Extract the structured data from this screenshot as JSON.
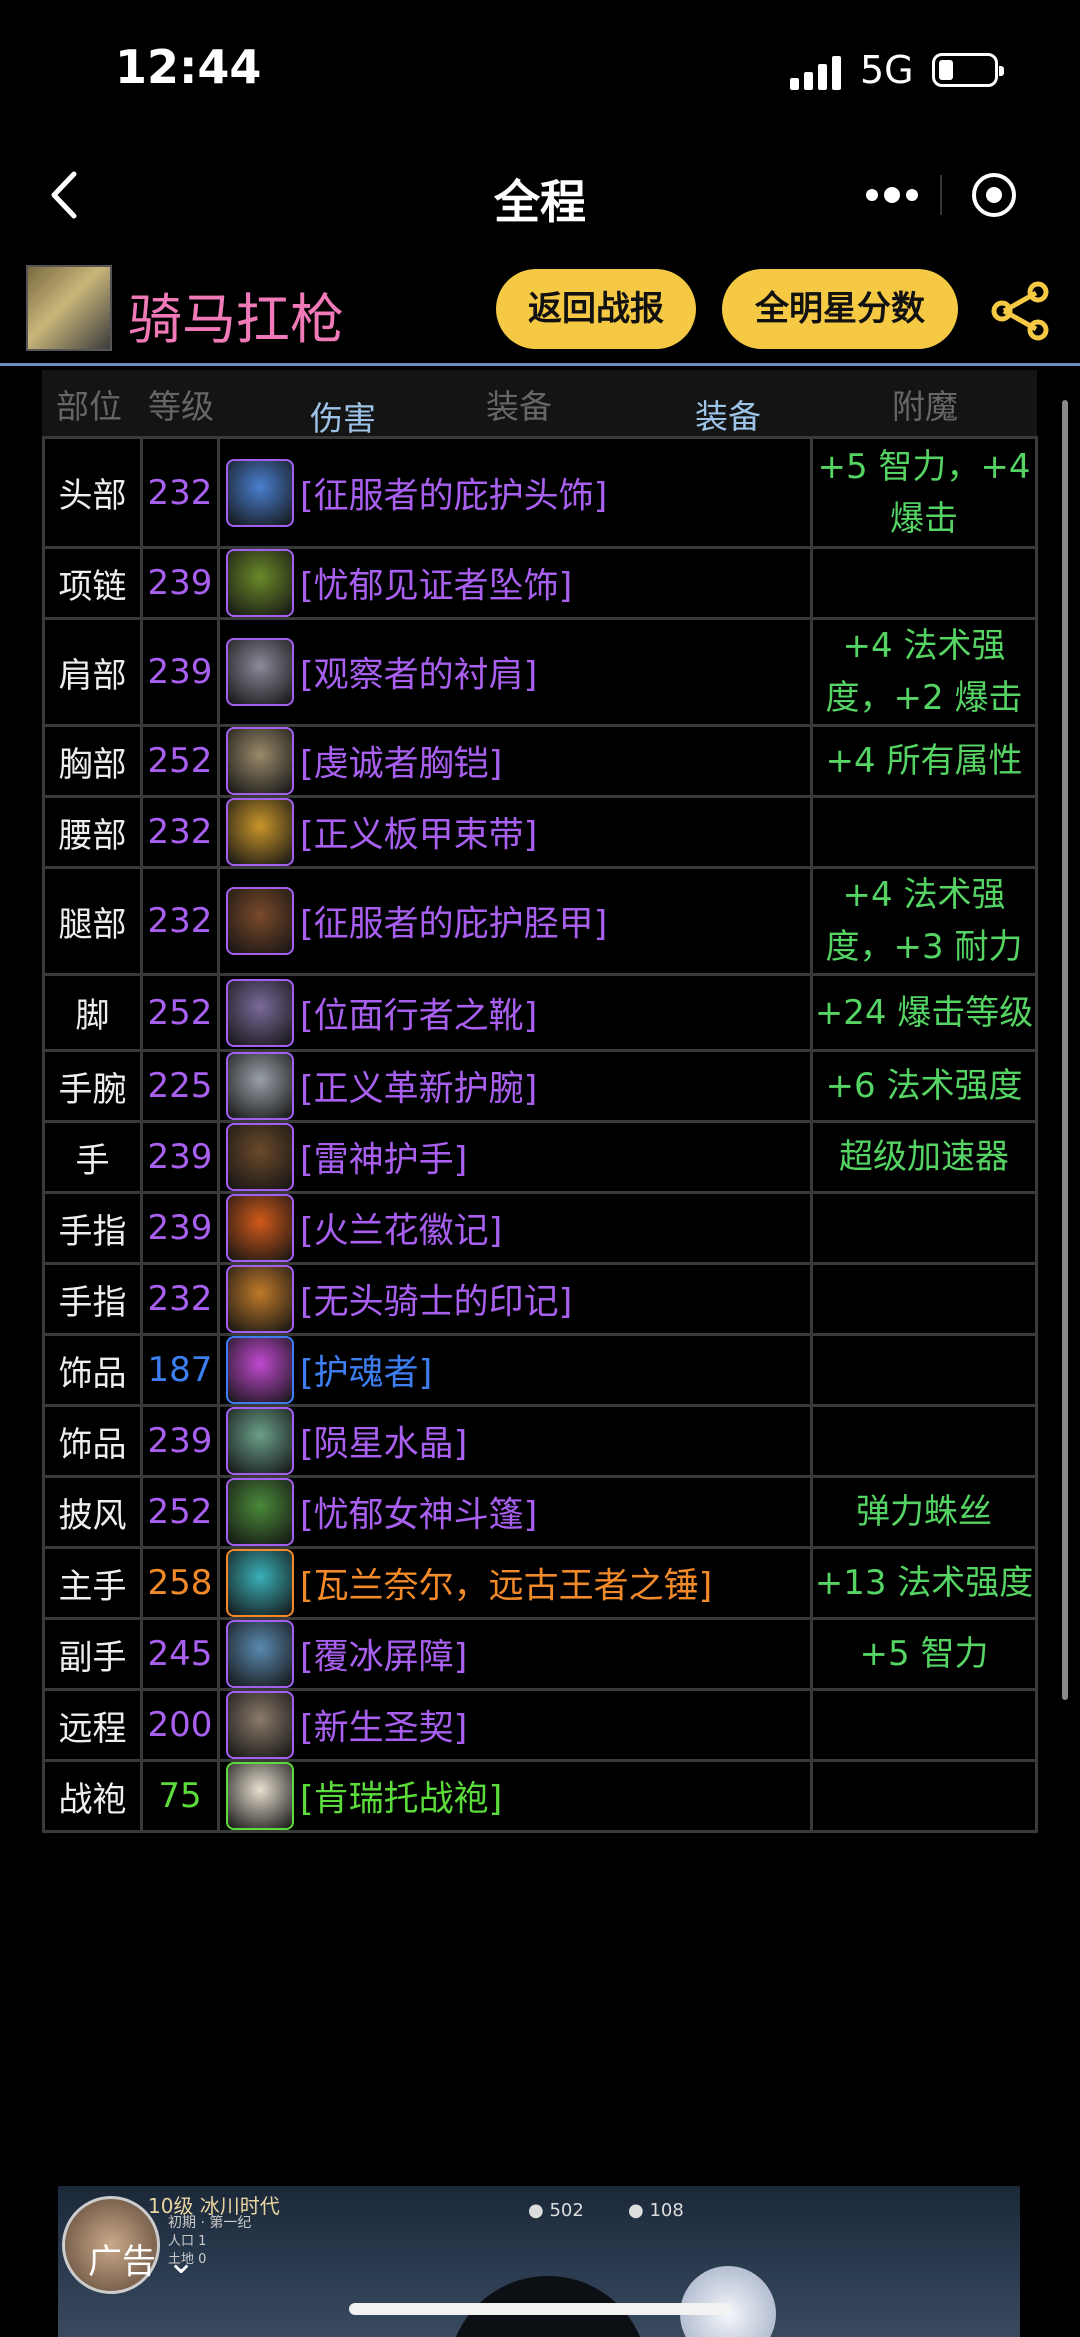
{
  "status": {
    "time": "12:44",
    "network": "5G"
  },
  "nav": {
    "title": "全程"
  },
  "header": {
    "player_name": "骑马扛枪",
    "return_button": "返回战报",
    "allstar_button": "全明星分数"
  },
  "columns": {
    "slot": "部位",
    "level": "等级",
    "damage": "伤害",
    "gear_inactive": "装备",
    "gear_active": "装备",
    "enchant": "附魔"
  },
  "gear": [
    {
      "slot": "头部",
      "level": "232",
      "item": "[征服者的庇护头饰]",
      "enchant": "+5 智力，+4 爆击",
      "quality": "epic",
      "icon": "helm-icon",
      "icon_color": "#4a7fd0"
    },
    {
      "slot": "项链",
      "level": "239",
      "item": "[忧郁见证者坠饰]",
      "enchant": "",
      "quality": "epic",
      "icon": "amulet-icon",
      "icon_color": "#6b8a2a"
    },
    {
      "slot": "肩部",
      "level": "239",
      "item": "[观察者的衬肩]",
      "enchant": "+4 法术强度，+2 爆击",
      "quality": "epic",
      "icon": "shoulder-icon",
      "icon_color": "#8a8a9a"
    },
    {
      "slot": "胸部",
      "level": "252",
      "item": "[虔诚者胸铠]",
      "enchant": "+4 所有属性",
      "quality": "epic",
      "icon": "chest-icon",
      "icon_color": "#9a8a6a"
    },
    {
      "slot": "腰部",
      "level": "232",
      "item": "[正义板甲束带]",
      "enchant": "",
      "quality": "epic",
      "icon": "belt-icon",
      "icon_color": "#c9962a"
    },
    {
      "slot": "腿部",
      "level": "232",
      "item": "[征服者的庇护胫甲]",
      "enchant": "+4 法术强度，+3 耐力",
      "quality": "epic",
      "icon": "legs-icon",
      "icon_color": "#7a4a2a"
    },
    {
      "slot": "脚",
      "level": "252",
      "item": "[位面行者之靴]",
      "enchant": "+24 爆击等级",
      "quality": "epic",
      "icon": "boots-icon",
      "icon_color": "#7a6a9a"
    },
    {
      "slot": "手腕",
      "level": "225",
      "item": "[正义革新护腕]",
      "enchant": "+6 法术强度",
      "quality": "epic",
      "icon": "bracer-icon",
      "icon_color": "#9aa0a8"
    },
    {
      "slot": "手",
      "level": "239",
      "item": "[雷神护手]",
      "enchant": "超级加速器",
      "quality": "epic",
      "icon": "gloves-icon",
      "icon_color": "#6a4a2a"
    },
    {
      "slot": "手指",
      "level": "239",
      "item": "[火兰花徽记]",
      "enchant": "",
      "quality": "epic",
      "icon": "ring-icon",
      "icon_color": "#d05a1a"
    },
    {
      "slot": "手指",
      "level": "232",
      "item": "[无头骑士的印记]",
      "enchant": "",
      "quality": "epic",
      "icon": "pumpkin-ring-icon",
      "icon_color": "#c07a2a"
    },
    {
      "slot": "饰品",
      "level": "187",
      "item": "[护魂者]",
      "enchant": "",
      "quality": "rare",
      "icon": "orb-trinket-icon",
      "icon_color": "#c04ad0"
    },
    {
      "slot": "饰品",
      "level": "239",
      "item": "[陨星水晶]",
      "enchant": "",
      "quality": "epic",
      "icon": "crystal-trinket-icon",
      "icon_color": "#6aa08a"
    },
    {
      "slot": "披风",
      "level": "252",
      "item": "[忧郁女神斗篷]",
      "enchant": "弹力蛛丝",
      "quality": "epic",
      "icon": "cloak-icon",
      "icon_color": "#4a8a3a"
    },
    {
      "slot": "主手",
      "level": "258",
      "item": "[瓦兰奈尔，远古王者之锤]",
      "enchant": "+13 法术强度",
      "quality": "legendary",
      "icon": "mace-icon",
      "icon_color": "#3ab0b8"
    },
    {
      "slot": "副手",
      "level": "245",
      "item": "[覆冰屏障]",
      "enchant": "+5 智力",
      "quality": "epic",
      "icon": "shield-icon",
      "icon_color": "#5a8ab0"
    },
    {
      "slot": "远程",
      "level": "200",
      "item": "[新生圣契]",
      "enchant": "",
      "quality": "epic",
      "icon": "libram-icon",
      "icon_color": "#8a7a6a"
    },
    {
      "slot": "战袍",
      "level": "75",
      "item": "[肯瑞托战袍]",
      "enchant": "",
      "quality": "uncommon",
      "icon": "tabard-icon",
      "icon_color": "#e8e0d0"
    }
  ],
  "ad": {
    "label": "广告",
    "level_text": "10级 冰川时代",
    "subtitle": "初期 · 第一纪",
    "row1": "人口    1",
    "row2": "土地    0",
    "res1": "502",
    "res2": "108"
  }
}
